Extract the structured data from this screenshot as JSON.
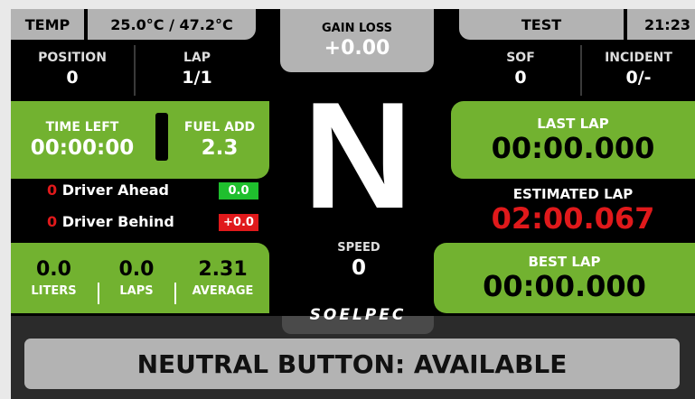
{
  "temp": {
    "label": "TEMP",
    "value": "25.0°C / 47.2°C"
  },
  "gain_loss": {
    "label": "GAIN LOSS",
    "value": "+0.00"
  },
  "session": {
    "label": "TEST",
    "clock": "21:23"
  },
  "position": {
    "label": "POSITION",
    "value": "0"
  },
  "lap": {
    "label": "LAP",
    "value": "1/1"
  },
  "sof": {
    "label": "SOF",
    "value": "0"
  },
  "incident": {
    "label": "INCIDENT",
    "value": "0/-"
  },
  "time_left": {
    "label": "TIME LEFT",
    "value": "00:00:00"
  },
  "fuel_add": {
    "label": "FUEL ADD",
    "value": "2.3"
  },
  "gear": "N",
  "speed": {
    "label": "SPEED",
    "value": "0"
  },
  "driver_ahead": {
    "pos": "0",
    "label": "Driver Ahead",
    "gap": "0.0"
  },
  "driver_behind": {
    "pos": "0",
    "label": "Driver Behind",
    "gap": "+0.0"
  },
  "fuel_stats": {
    "liters": {
      "value": "0.0",
      "label": "LITERS"
    },
    "laps": {
      "value": "0.0",
      "label": "LAPS"
    },
    "average": {
      "value": "2.31",
      "label": "AVERAGE"
    }
  },
  "last_lap": {
    "label": "LAST LAP",
    "value": "00:00.000"
  },
  "estimated_lap": {
    "label": "ESTIMATED LAP",
    "value": "02:00.067"
  },
  "best_lap": {
    "label": "BEST LAP",
    "value": "00:00.000"
  },
  "logo": "SOELPEC",
  "neutral_banner": "NEUTRAL BUTTON: AVAILABLE",
  "colors": {
    "green": "#72b230",
    "red": "#e0191b",
    "grey_panel": "#b3b3b3",
    "ahead_badge": "#1fbf2e",
    "behind_badge": "#e0191b"
  }
}
